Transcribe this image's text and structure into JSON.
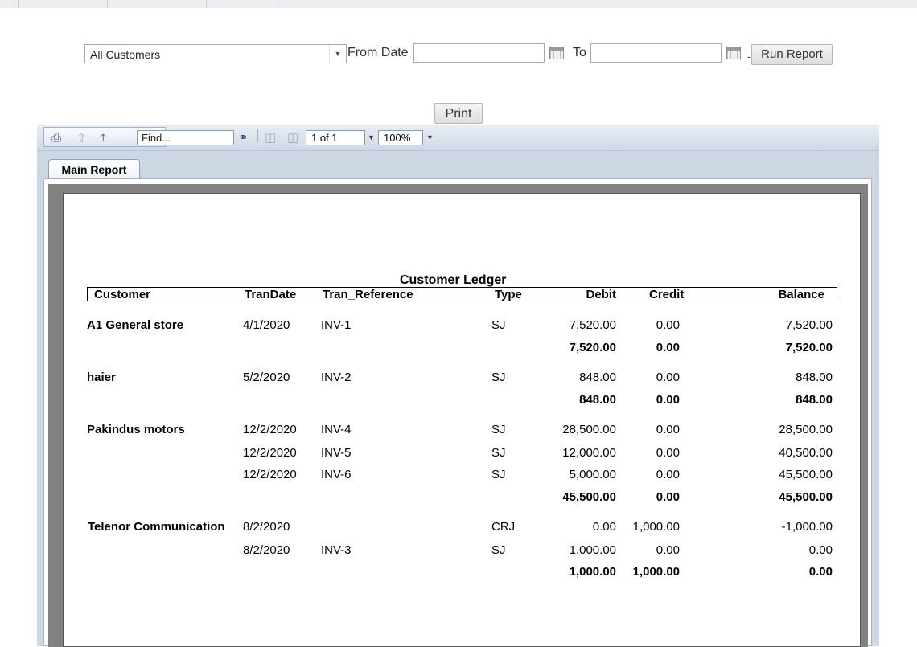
{
  "filters": {
    "customer_select": "All Customers",
    "from_date_label": "From Date",
    "from_date_value": "",
    "to_label": "To",
    "to_date_value": "",
    "dash": "-",
    "run_report_label": "Run Report"
  },
  "print_label": "Print",
  "toolbar": {
    "find_placeholder": "Find...",
    "page_value": "1 of 1",
    "zoom_value": "100%"
  },
  "tab_label": "Main Report",
  "report": {
    "title": "Customer Ledger",
    "headers": {
      "customer": "Customer",
      "trandate": "TranDate",
      "tran_reference": "Tran_Reference",
      "type": "Type",
      "debit": "Debit",
      "credit": "Credit",
      "balance": "Balance"
    },
    "groups": [
      {
        "customer": "A1 General store",
        "rows": [
          {
            "date": "4/1/2020",
            "ref": "INV-1",
            "type": "SJ",
            "debit": "7,520.00",
            "credit": "0.00",
            "balance": "7,520.00"
          }
        ],
        "total": {
          "debit": "7,520.00",
          "credit": "0.00",
          "balance": "7,520.00"
        }
      },
      {
        "customer": "haier",
        "rows": [
          {
            "date": "5/2/2020",
            "ref": "INV-2",
            "type": "SJ",
            "debit": "848.00",
            "credit": "0.00",
            "balance": "848.00"
          }
        ],
        "total": {
          "debit": "848.00",
          "credit": "0.00",
          "balance": "848.00"
        }
      },
      {
        "customer": "Pakindus motors",
        "rows": [
          {
            "date": "12/2/2020",
            "ref": "INV-4",
            "type": "SJ",
            "debit": "28,500.00",
            "credit": "0.00",
            "balance": "28,500.00"
          },
          {
            "date": "12/2/2020",
            "ref": "INV-5",
            "type": "SJ",
            "debit": "12,000.00",
            "credit": "0.00",
            "balance": "40,500.00"
          },
          {
            "date": "12/2/2020",
            "ref": "INV-6",
            "type": "SJ",
            "debit": "5,000.00",
            "credit": "0.00",
            "balance": "45,500.00"
          }
        ],
        "total": {
          "debit": "45,500.00",
          "credit": "0.00",
          "balance": "45,500.00"
        }
      },
      {
        "customer": "Telenor Communication",
        "rows": [
          {
            "date": "8/2/2020",
            "ref": "",
            "type": "CRJ",
            "debit": "0.00",
            "credit": "1,000.00",
            "balance": "-1,000.00"
          },
          {
            "date": "8/2/2020",
            "ref": "INV-3",
            "type": "SJ",
            "debit": "1,000.00",
            "credit": "0.00",
            "balance": "0.00"
          }
        ],
        "total": {
          "debit": "1,000.00",
          "credit": "1,000.00",
          "balance": "0.00"
        }
      }
    ]
  }
}
